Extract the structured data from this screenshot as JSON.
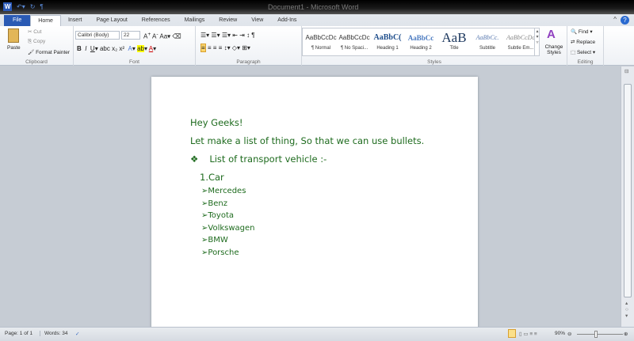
{
  "window": {
    "title": "Document1 - Microsoft Word"
  },
  "tabs": [
    "File",
    "Home",
    "Insert",
    "Page Layout",
    "References",
    "Mailings",
    "Review",
    "View",
    "Add-Ins"
  ],
  "clipboard": {
    "paste": "Paste",
    "cut": "Cut",
    "copy": "Copy",
    "format_painter": "Format Painter",
    "label": "Clipboard"
  },
  "font": {
    "name": "Calibri (Body)",
    "size": "22",
    "label": "Font"
  },
  "paragraph": {
    "label": "Paragraph"
  },
  "styles": {
    "items": [
      {
        "preview": "AaBbCcDc",
        "name": "¶ Normal"
      },
      {
        "preview": "AaBbCcDc",
        "name": "¶ No Spaci..."
      },
      {
        "preview": "AaBbC(",
        "name": "Heading 1"
      },
      {
        "preview": "AaBbCc",
        "name": "Heading 2"
      },
      {
        "preview": "AaB",
        "name": "Title"
      },
      {
        "preview": "AaBbCc.",
        "name": "Subtitle"
      },
      {
        "preview": "AaBbCcDc",
        "name": "Subtle Em..."
      }
    ],
    "change": "Change Styles",
    "label": "Styles"
  },
  "editing": {
    "find": "Find",
    "replace": "Replace",
    "select": "Select",
    "label": "Editing"
  },
  "document": {
    "line1": "Hey Geeks!",
    "line2": "Let make a list of thing, So that we can use bullets.",
    "bullet": "List of transport vehicle :-",
    "numbered": "1.Car",
    "sub_items": [
      "Mercedes",
      "Benz",
      "Toyota",
      "Volkswagen",
      "BMW",
      "Porsche"
    ],
    "text_color": "#1e6b1e"
  },
  "status": {
    "page": "Page: 1 of 1",
    "words": "Words: 34",
    "zoom": "90%"
  }
}
